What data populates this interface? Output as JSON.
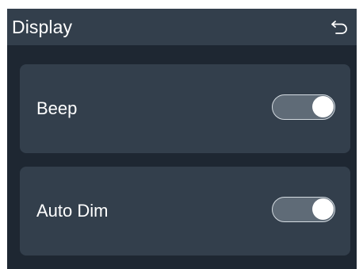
{
  "header": {
    "title": "Display",
    "back_icon": "back-arrow-icon"
  },
  "settings": [
    {
      "label": "Beep",
      "enabled": true
    },
    {
      "label": "Auto Dim",
      "enabled": true
    }
  ],
  "colors": {
    "background": "#1e2732",
    "panel": "#333f4c",
    "text": "#ffffff",
    "toggle_track": "#5f6b77",
    "toggle_border": "#d4dbe1",
    "toggle_knob": "#ffffff"
  }
}
